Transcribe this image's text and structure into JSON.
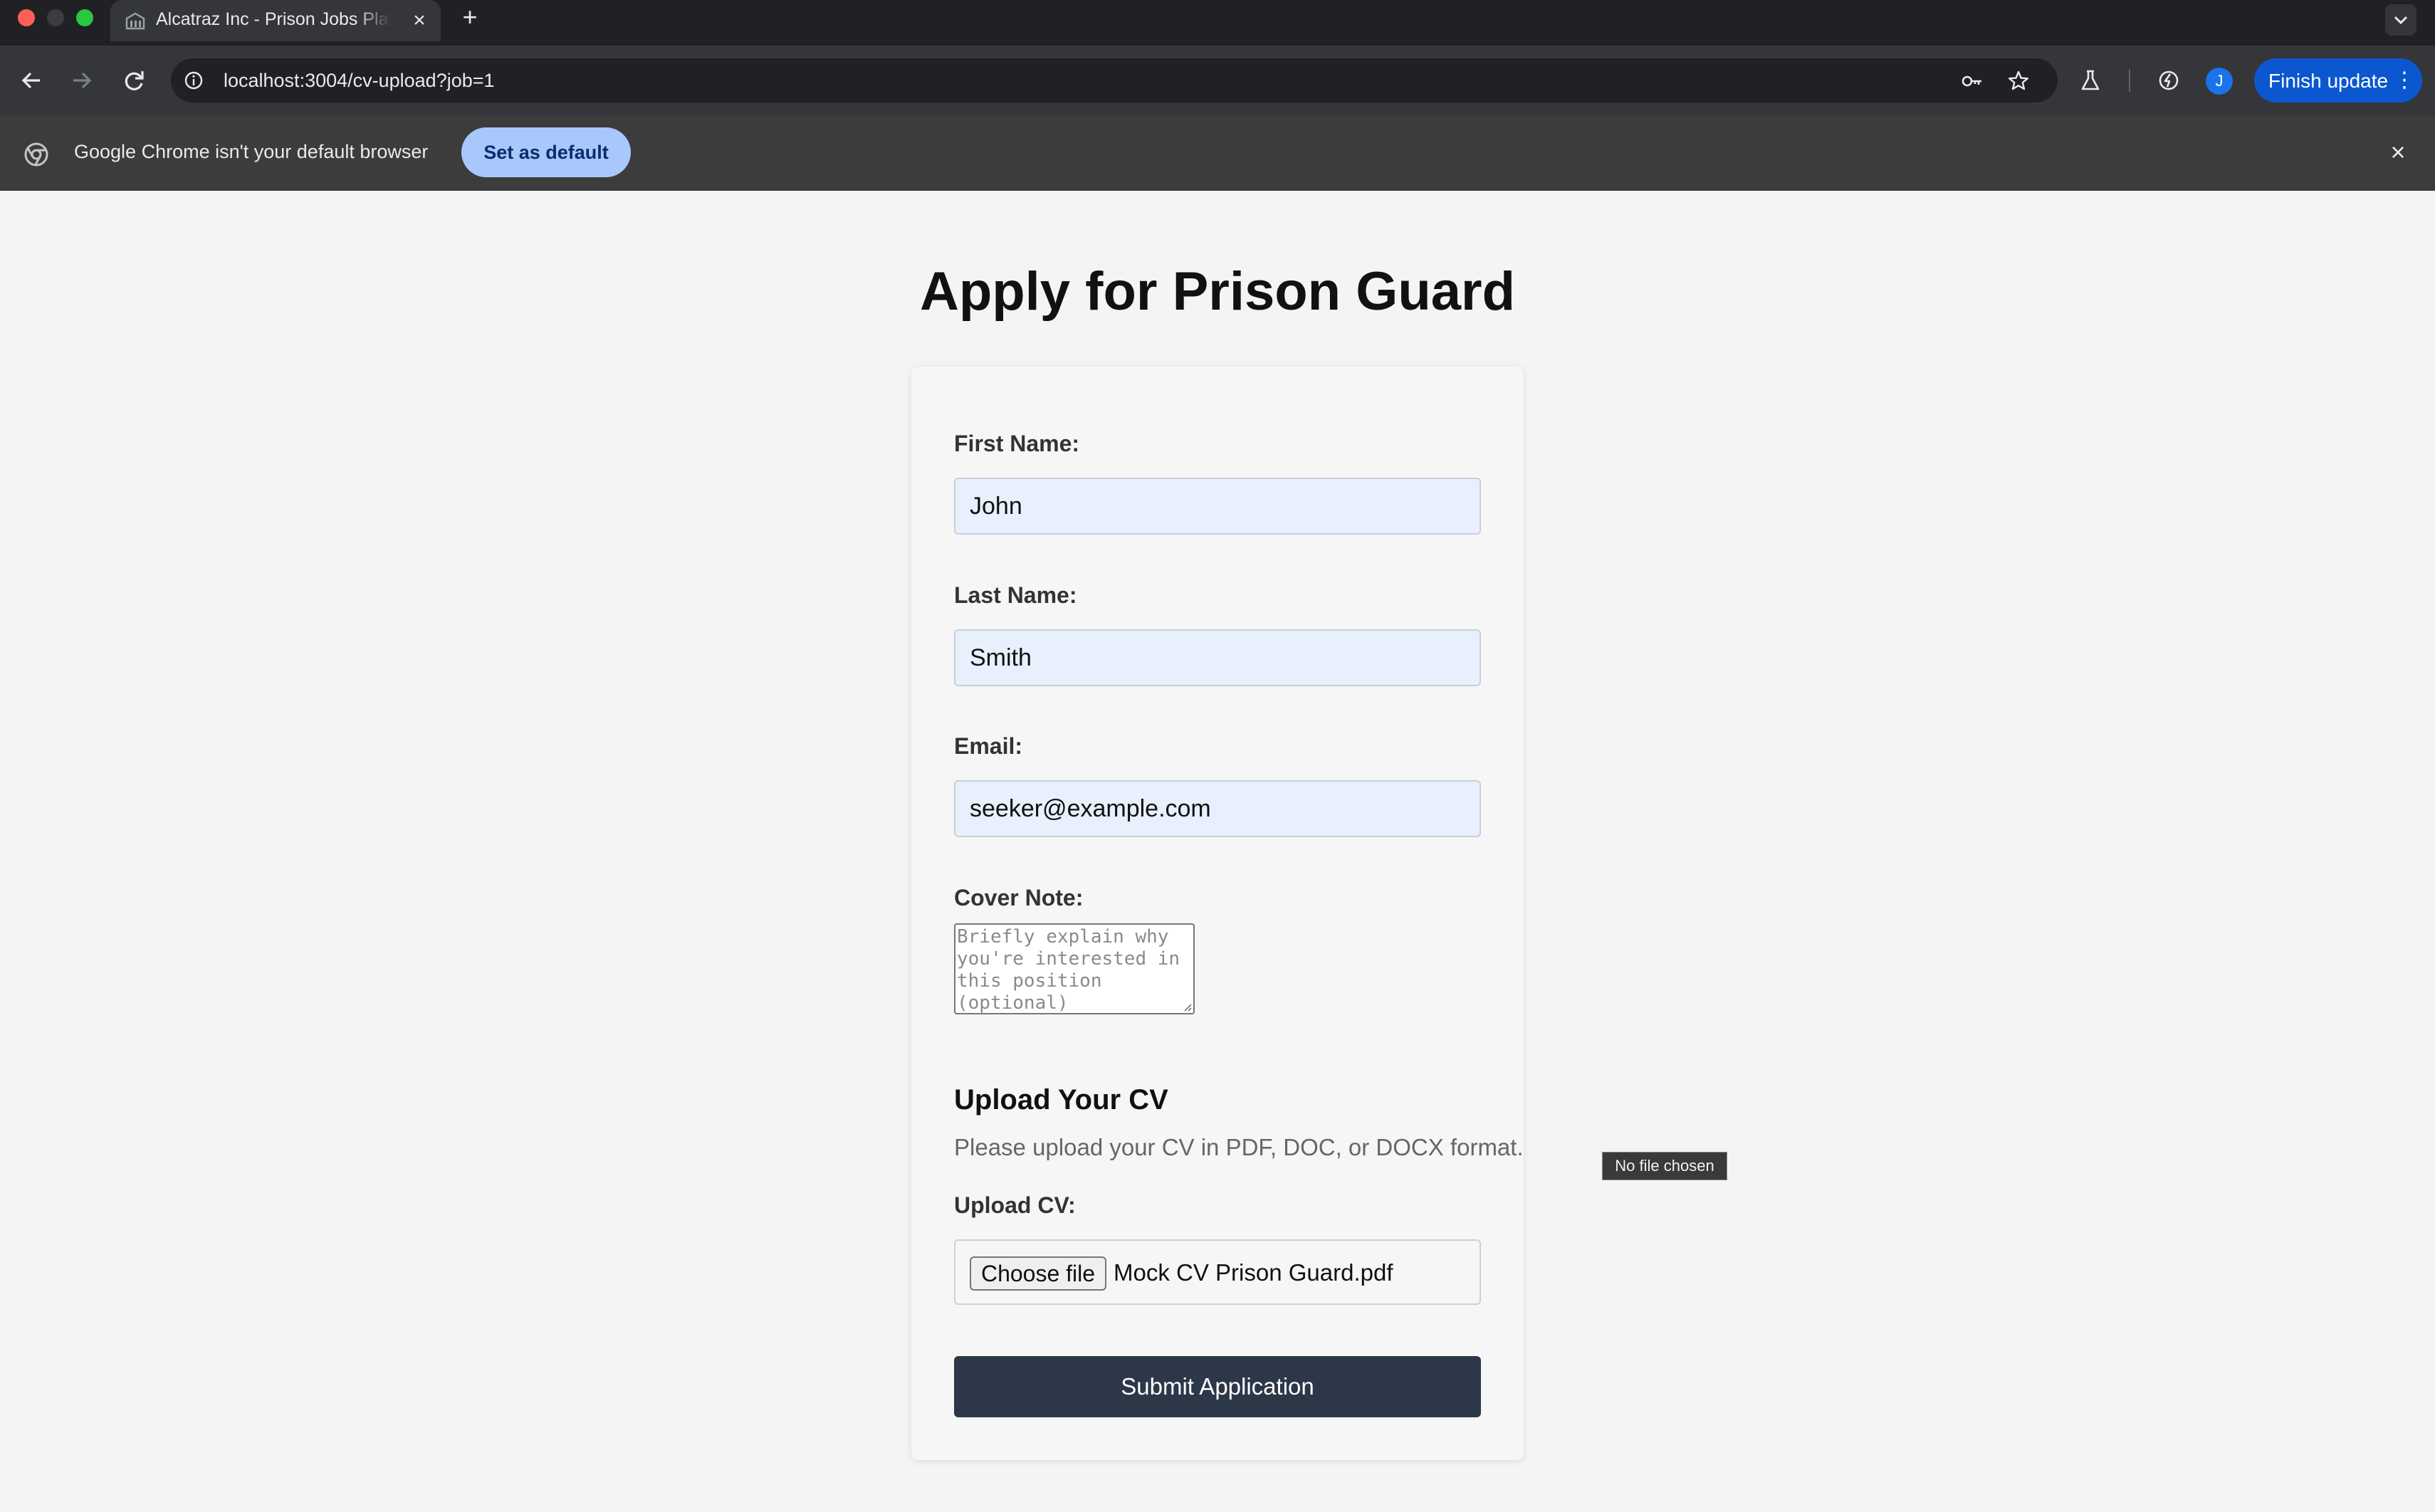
{
  "browser": {
    "tab": {
      "title": "Alcatraz Inc - Prison Jobs Platform"
    },
    "new_tab_symbol": "+",
    "tab_close_symbol": "×",
    "url": "localhost:3004/cv-upload?job=1",
    "profile_initial": "J",
    "finish_update_label": "Finish update",
    "more_menu_symbol": "⋮",
    "infobar": {
      "message": "Google Chrome isn't your default browser",
      "button_label": "Set as default",
      "close_symbol": "×"
    }
  },
  "page": {
    "title": "Apply for Prison Guard",
    "form": {
      "first_name": {
        "label": "First Name:",
        "value": "John"
      },
      "last_name": {
        "label": "Last Name:",
        "value": "Smith"
      },
      "email": {
        "label": "Email:",
        "value": "seeker@example.com"
      },
      "cover_note": {
        "label": "Cover Note:",
        "placeholder": "Briefly explain why you're interested in this position (optional)"
      },
      "upload_section": {
        "heading": "Upload Your CV",
        "help": "Please upload your CV in PDF, DOC, or DOCX format.",
        "label": "Upload CV:",
        "choose_button": "Choose file",
        "file_name": "Mock CV Prison Guard.pdf"
      },
      "submit_label": "Submit Application"
    },
    "tooltip": "No file chosen"
  },
  "colors": {
    "chrome_dark": "#202124",
    "toolbar": "#35363a",
    "accent_blue": "#0b57d0",
    "autofill_field": "#e8f0fe",
    "submit_button": "#2c3748"
  }
}
